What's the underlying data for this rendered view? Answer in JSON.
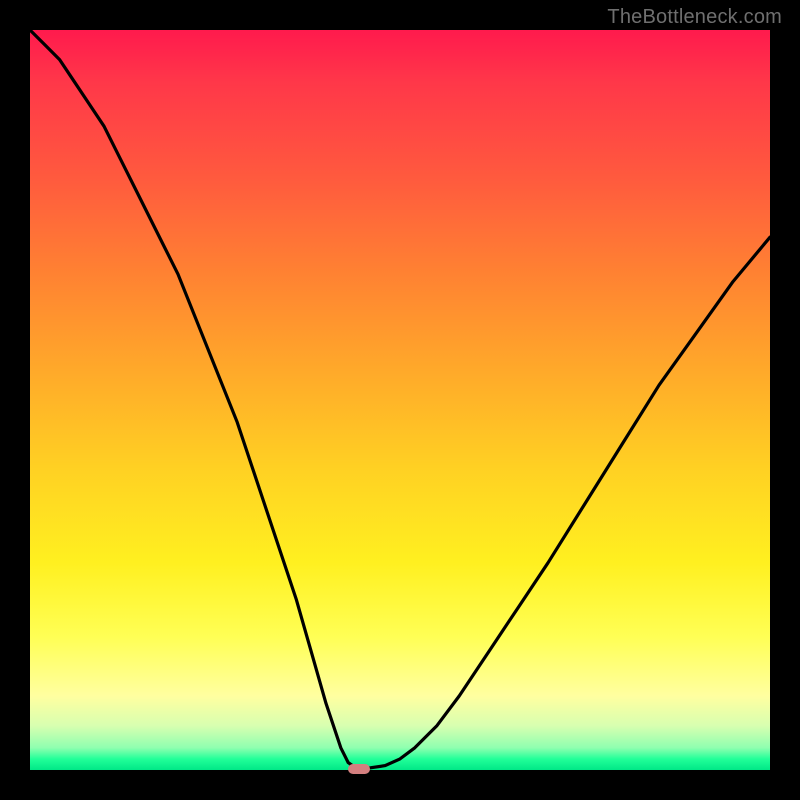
{
  "watermark": "TheBottleneck.com",
  "chart_data": {
    "type": "line",
    "title": "",
    "xlabel": "",
    "ylabel": "",
    "xlim": [
      0,
      100
    ],
    "ylim": [
      0,
      100
    ],
    "x": [
      0,
      2,
      4,
      6,
      8,
      10,
      12,
      14,
      16,
      18,
      20,
      22,
      24,
      26,
      28,
      30,
      32,
      34,
      36,
      38,
      40,
      42,
      43,
      44,
      45,
      46,
      48,
      50,
      52,
      55,
      58,
      62,
      66,
      70,
      75,
      80,
      85,
      90,
      95,
      100
    ],
    "y": [
      100,
      98,
      96,
      93,
      90,
      87,
      83,
      79,
      75,
      71,
      67,
      62,
      57,
      52,
      47,
      41,
      35,
      29,
      23,
      16,
      9,
      3,
      1,
      0.3,
      0.2,
      0.3,
      0.6,
      1.5,
      3,
      6,
      10,
      16,
      22,
      28,
      36,
      44,
      52,
      59,
      66,
      72
    ],
    "marker": {
      "x": 44.5,
      "y": 0.2
    },
    "series": [
      {
        "name": "bottleneck-curve",
        "color": "#000000"
      }
    ]
  },
  "colors": {
    "frame": "#000000",
    "curve": "#000000",
    "marker": "#d47f7f",
    "watermark": "#6f6f6f"
  }
}
